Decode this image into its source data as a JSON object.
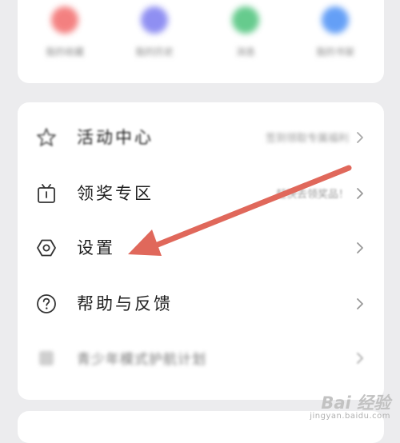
{
  "colors": {
    "background": "#ececee",
    "card": "#ffffff",
    "arrow": "#e0685b",
    "shortcut_red": "#f26b6b",
    "shortcut_purple": "#7c7cf0",
    "shortcut_green": "#4cc27a",
    "shortcut_blue": "#4a8ff5"
  },
  "shortcuts": [
    {
      "icon": "red-shortcut-icon",
      "label": "我的收藏"
    },
    {
      "icon": "purple-shortcut-icon",
      "label": "我的历史"
    },
    {
      "icon": "green-shortcut-icon",
      "label": "消息"
    },
    {
      "icon": "blue-shortcut-icon",
      "label": "我的书架"
    }
  ],
  "menu": {
    "activity": {
      "label": "活动中心",
      "hint": "签到领取专属福利",
      "icon": "star-icon"
    },
    "rewards": {
      "label": "领奖专区",
      "hint": "赶快去领奖品！",
      "icon": "gift-box-icon"
    },
    "settings": {
      "label": "设置",
      "icon": "hexagon-settings-icon"
    },
    "help": {
      "label": "帮助与反馈",
      "icon": "question-circle-icon"
    },
    "plan": {
      "label": "青少年模式护航计划",
      "icon": "shield-icon"
    }
  },
  "watermark": {
    "brand": "Bai 经验",
    "url": "jingyan.baidu.com"
  }
}
